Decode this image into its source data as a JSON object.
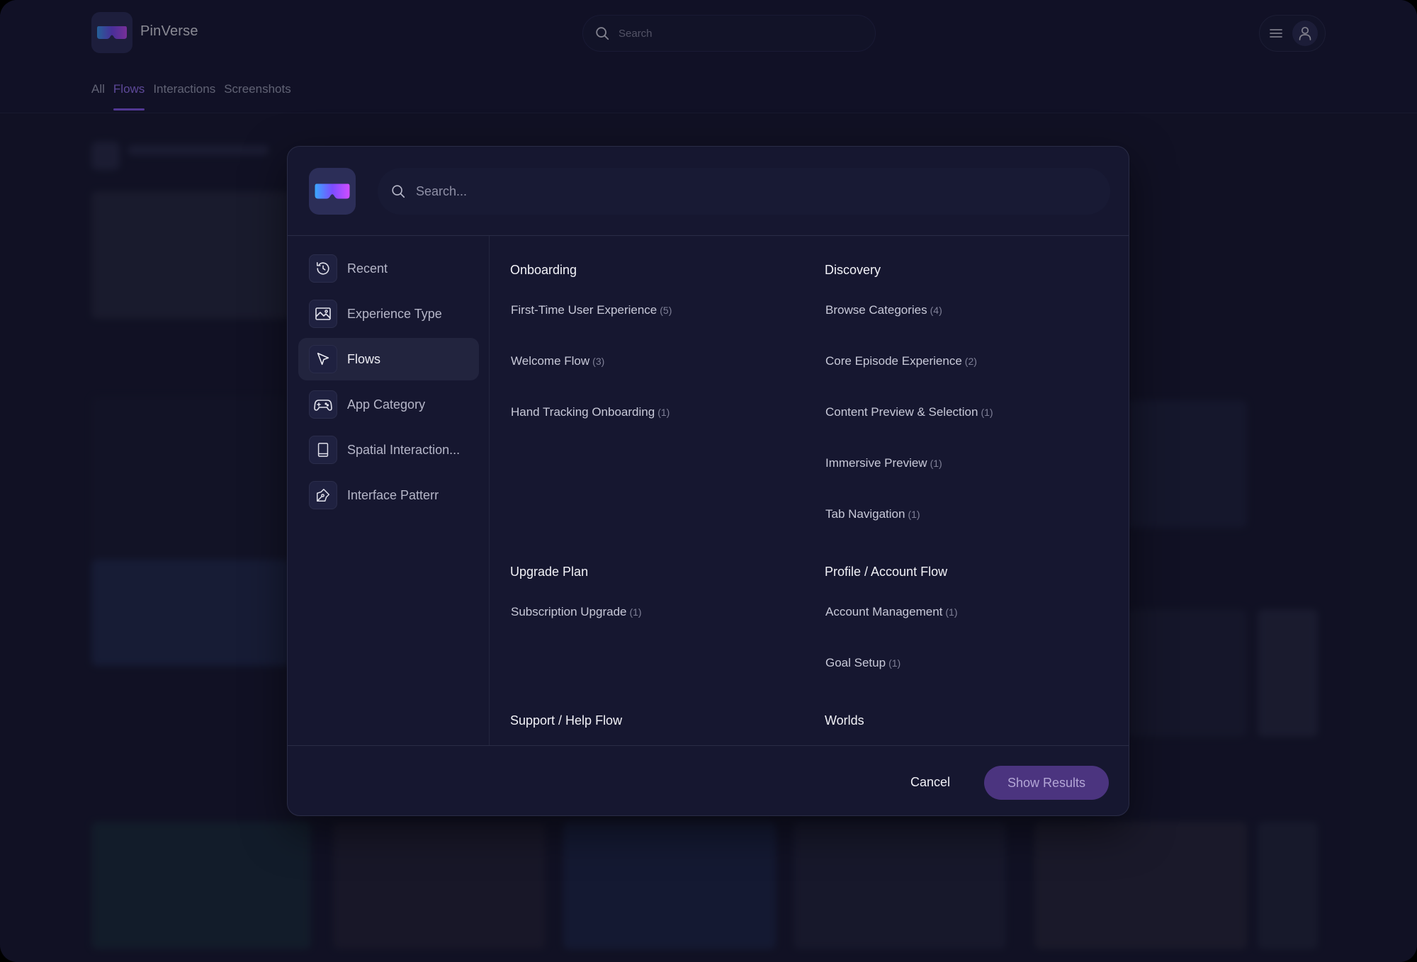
{
  "app": {
    "brand": "PinVerse",
    "logo_icon": "vr-headset-icon"
  },
  "header": {
    "search_placeholder": "Search",
    "tabs": [
      {
        "label": "All",
        "active": false
      },
      {
        "label": "Flows",
        "active": true
      },
      {
        "label": "Interactions",
        "active": false
      },
      {
        "label": "Screenshots",
        "active": false
      }
    ]
  },
  "modal": {
    "search_placeholder": "Search...",
    "sidebar": [
      {
        "label": "Recent",
        "icon": "history-icon",
        "active": false
      },
      {
        "label": "Experience Type",
        "icon": "image-icon",
        "active": false
      },
      {
        "label": "Flows",
        "icon": "cursor-arrow-icon",
        "active": true
      },
      {
        "label": "App Category",
        "icon": "gamepad-icon",
        "active": false
      },
      {
        "label": "Spatial Interaction...",
        "icon": "book-icon",
        "active": false
      },
      {
        "label": "Interface Patterr",
        "icon": "pen-tool-icon",
        "active": false
      }
    ],
    "groups": {
      "onboarding": {
        "title": "Onboarding",
        "items": [
          {
            "label": "First-Time User Experience",
            "count": "(5)"
          },
          {
            "label": "Welcome Flow",
            "count": "(3)"
          },
          {
            "label": "Hand Tracking Onboarding",
            "count": "(1)"
          }
        ]
      },
      "discovery": {
        "title": "Discovery",
        "items": [
          {
            "label": "Browse Categories",
            "count": "(4)"
          },
          {
            "label": "Core Episode Experience",
            "count": "(2)"
          },
          {
            "label": "Content Preview & Selection",
            "count": "(1)"
          },
          {
            "label": "Immersive Preview",
            "count": "(1)"
          },
          {
            "label": "Tab Navigation",
            "count": "(1)"
          }
        ]
      },
      "upgrade": {
        "title": "Upgrade Plan",
        "items": [
          {
            "label": "Subscription Upgrade",
            "count": "(1)"
          }
        ]
      },
      "profile": {
        "title": "Profile / Account Flow",
        "items": [
          {
            "label": "Account Management",
            "count": "(1)"
          },
          {
            "label": "Goal Setup",
            "count": "(1)"
          }
        ]
      },
      "support": {
        "title": "Support / Help Flow"
      },
      "worlds": {
        "title": "Worlds"
      }
    },
    "footer": {
      "cancel_label": "Cancel",
      "show_label": "Show Results"
    }
  },
  "colors": {
    "accent": "#8b5cf6",
    "background": "#16172c",
    "button": "#4b347f"
  }
}
